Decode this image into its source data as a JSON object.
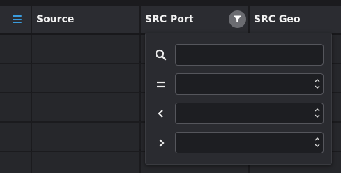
{
  "header": {
    "columns": [
      {
        "label": ""
      },
      {
        "label": "Source"
      },
      {
        "label": "SRC Port"
      },
      {
        "label": "SRC Geo"
      }
    ]
  },
  "icons": {
    "menu": "hamburger-menu-icon",
    "filter": "funnel-filter-icon",
    "search": "search-icon",
    "equals": "equals-icon",
    "less_than": "chevron-left-icon",
    "greater_than": "chevron-right-icon"
  },
  "filter_popup": {
    "search_value": "",
    "equals_value": "",
    "less_than_value": "",
    "greater_than_value": ""
  },
  "colors": {
    "accent": "#3a9bdc",
    "header_bg": "#2b2c31",
    "row_bg": "#26272b",
    "popup_bg": "#2a2b30"
  }
}
